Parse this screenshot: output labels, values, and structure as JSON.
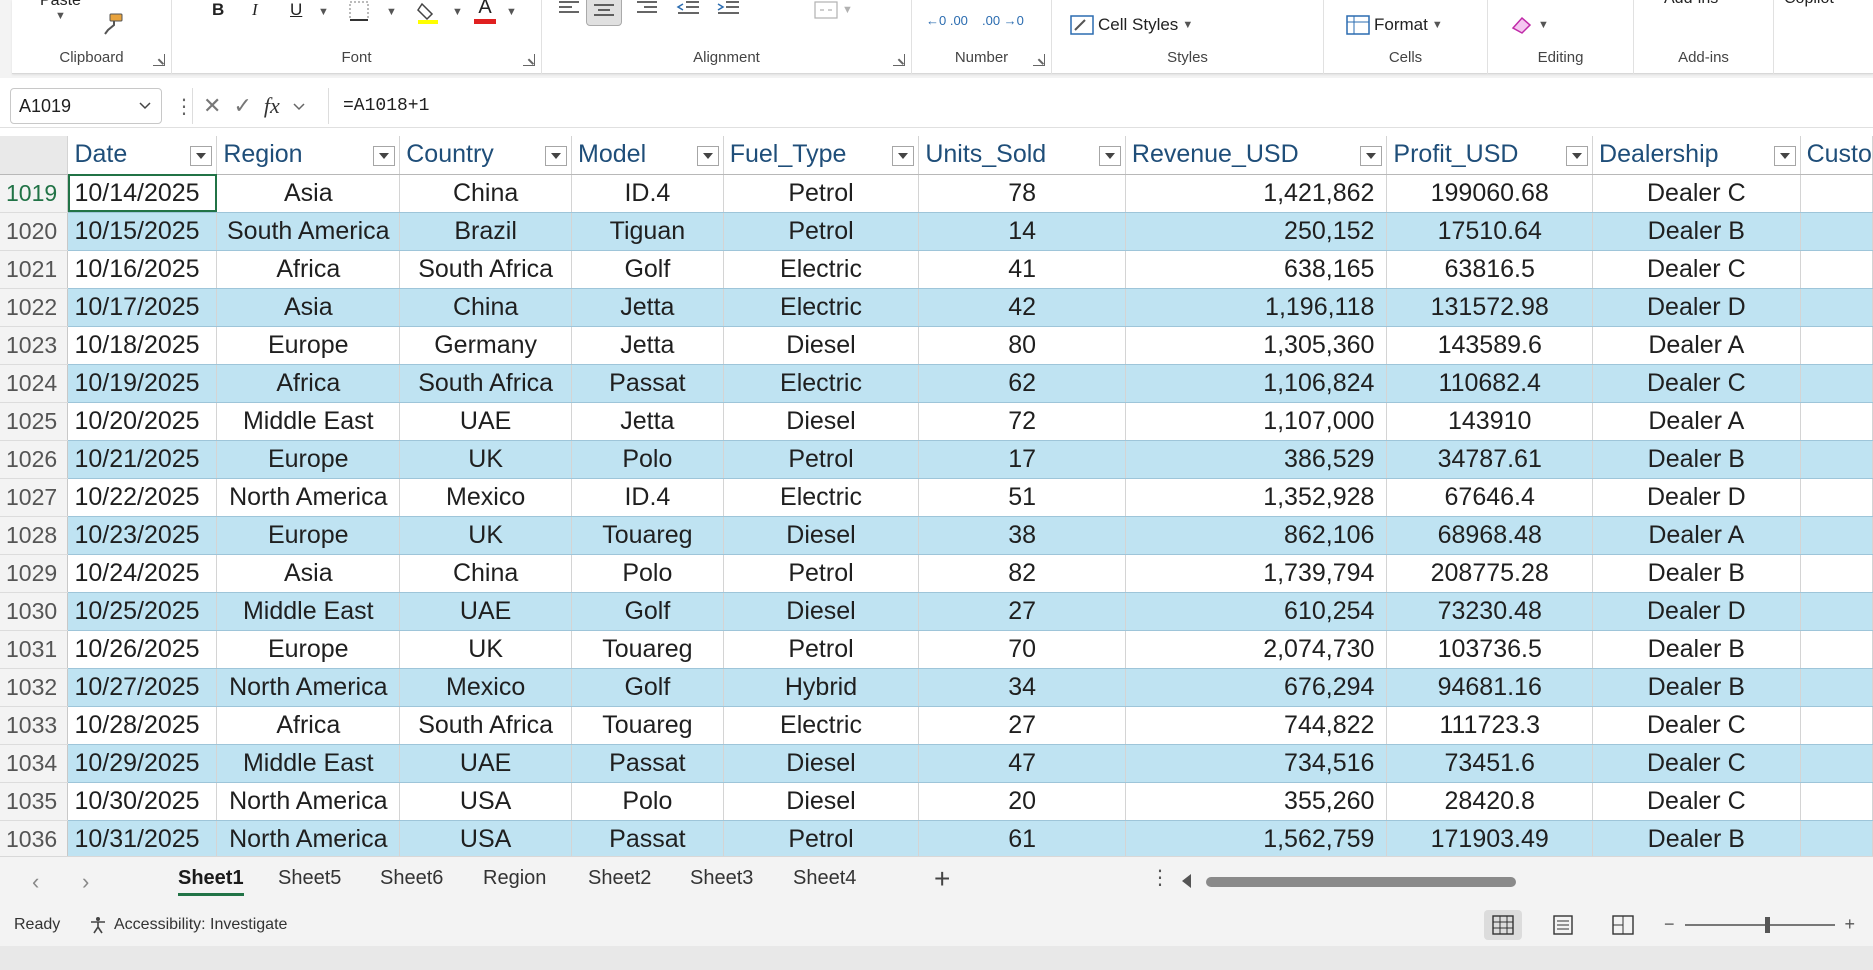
{
  "ribbon": {
    "clipboard": {
      "label": "Clipboard",
      "paste": "Paste"
    },
    "font": {
      "label": "Font",
      "bold": "B",
      "italic": "I",
      "underline": "U",
      "font_color": "A"
    },
    "alignment": {
      "label": "Alignment"
    },
    "number": {
      "label": "Number",
      "increase_decimal": "←0 .00",
      "decrease_decimal": ".00 →0"
    },
    "styles": {
      "label": "Styles",
      "cell_styles": "Cell Styles"
    },
    "cells": {
      "label": "Cells",
      "format": "Format"
    },
    "editing": {
      "label": "Editing"
    },
    "addins": {
      "label": "Add-ins",
      "addins_btn": "Add-ins",
      "copilot": "Copilot"
    }
  },
  "formula_bar": {
    "name_box": "A1019",
    "fx": "fx",
    "formula": "=A1018+1"
  },
  "grid": {
    "headers": [
      "Date",
      "Region",
      "Country",
      "Model",
      "Fuel_Type",
      "Units_Sold",
      "Revenue_USD",
      "Profit_USD",
      "Dealership",
      "Custo"
    ],
    "rows": [
      {
        "n": "1019",
        "cells": [
          "10/14/2025",
          "Asia",
          "China",
          "ID.4",
          "Petrol",
          "78",
          "1,421,862",
          "199060.68",
          "Dealer C"
        ]
      },
      {
        "n": "1020",
        "cells": [
          "10/15/2025",
          "South America",
          "Brazil",
          "Tiguan",
          "Petrol",
          "14",
          "250,152",
          "17510.64",
          "Dealer B"
        ]
      },
      {
        "n": "1021",
        "cells": [
          "10/16/2025",
          "Africa",
          "South Africa",
          "Golf",
          "Electric",
          "41",
          "638,165",
          "63816.5",
          "Dealer C"
        ]
      },
      {
        "n": "1022",
        "cells": [
          "10/17/2025",
          "Asia",
          "China",
          "Jetta",
          "Electric",
          "42",
          "1,196,118",
          "131572.98",
          "Dealer D"
        ]
      },
      {
        "n": "1023",
        "cells": [
          "10/18/2025",
          "Europe",
          "Germany",
          "Jetta",
          "Diesel",
          "80",
          "1,305,360",
          "143589.6",
          "Dealer A"
        ]
      },
      {
        "n": "1024",
        "cells": [
          "10/19/2025",
          "Africa",
          "South Africa",
          "Passat",
          "Electric",
          "62",
          "1,106,824",
          "110682.4",
          "Dealer C"
        ]
      },
      {
        "n": "1025",
        "cells": [
          "10/20/2025",
          "Middle East",
          "UAE",
          "Jetta",
          "Diesel",
          "72",
          "1,107,000",
          "143910",
          "Dealer A"
        ]
      },
      {
        "n": "1026",
        "cells": [
          "10/21/2025",
          "Europe",
          "UK",
          "Polo",
          "Petrol",
          "17",
          "386,529",
          "34787.61",
          "Dealer B"
        ]
      },
      {
        "n": "1027",
        "cells": [
          "10/22/2025",
          "North America",
          "Mexico",
          "ID.4",
          "Electric",
          "51",
          "1,352,928",
          "67646.4",
          "Dealer D"
        ]
      },
      {
        "n": "1028",
        "cells": [
          "10/23/2025",
          "Europe",
          "UK",
          "Touareg",
          "Diesel",
          "38",
          "862,106",
          "68968.48",
          "Dealer A"
        ]
      },
      {
        "n": "1029",
        "cells": [
          "10/24/2025",
          "Asia",
          "China",
          "Polo",
          "Petrol",
          "82",
          "1,739,794",
          "208775.28",
          "Dealer B"
        ]
      },
      {
        "n": "1030",
        "cells": [
          "10/25/2025",
          "Middle East",
          "UAE",
          "Golf",
          "Diesel",
          "27",
          "610,254",
          "73230.48",
          "Dealer D"
        ]
      },
      {
        "n": "1031",
        "cells": [
          "10/26/2025",
          "Europe",
          "UK",
          "Touareg",
          "Petrol",
          "70",
          "2,074,730",
          "103736.5",
          "Dealer B"
        ]
      },
      {
        "n": "1032",
        "cells": [
          "10/27/2025",
          "North America",
          "Mexico",
          "Golf",
          "Hybrid",
          "34",
          "676,294",
          "94681.16",
          "Dealer B"
        ]
      },
      {
        "n": "1033",
        "cells": [
          "10/28/2025",
          "Africa",
          "South Africa",
          "Touareg",
          "Electric",
          "27",
          "744,822",
          "111723.3",
          "Dealer C"
        ]
      },
      {
        "n": "1034",
        "cells": [
          "10/29/2025",
          "Middle East",
          "UAE",
          "Passat",
          "Diesel",
          "47",
          "734,516",
          "73451.6",
          "Dealer C"
        ]
      },
      {
        "n": "1035",
        "cells": [
          "10/30/2025",
          "North America",
          "USA",
          "Polo",
          "Diesel",
          "20",
          "355,260",
          "28420.8",
          "Dealer C"
        ]
      },
      {
        "n": "1036",
        "cells": [
          "10/31/2025",
          "North America",
          "USA",
          "Passat",
          "Petrol",
          "61",
          "1,562,759",
          "171903.49",
          "Dealer B"
        ]
      }
    ]
  },
  "sheet_tabs": [
    "Sheet1",
    "Sheet5",
    "Sheet6",
    "Region",
    "Sheet2",
    "Sheet3",
    "Sheet4"
  ],
  "status": {
    "ready": "Ready",
    "accessibility": "Accessibility: Investigate",
    "zoom_minus": "−",
    "zoom_plus": "+"
  }
}
